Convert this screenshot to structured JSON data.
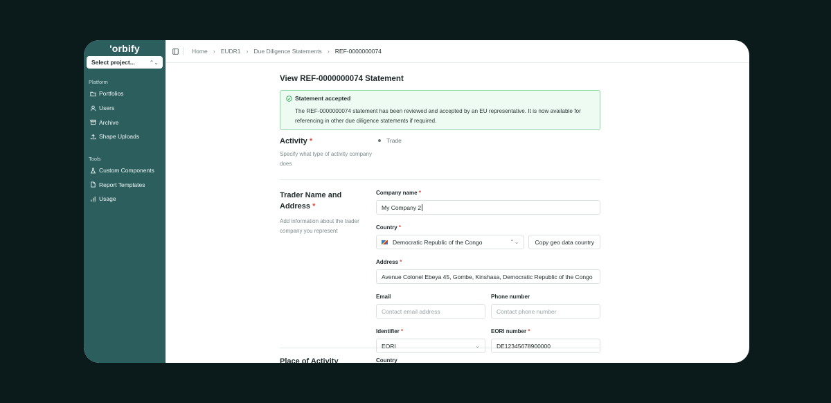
{
  "sidebar": {
    "logo": "'orbify",
    "project_select": "Select project...",
    "platform_label": "Platform",
    "platform_items": [
      {
        "label": "Portfolios",
        "icon": "folder-icon"
      },
      {
        "label": "Users",
        "icon": "user-icon"
      },
      {
        "label": "Archive",
        "icon": "archive-icon"
      },
      {
        "label": "Shape Uploads",
        "icon": "upload-icon"
      }
    ],
    "tools_label": "Tools",
    "tools_items": [
      {
        "label": "Custom Components",
        "icon": "flask-icon"
      },
      {
        "label": "Report Templates",
        "icon": "document-icon"
      },
      {
        "label": "Usage",
        "icon": "bar-chart-icon"
      }
    ]
  },
  "breadcrumb": [
    "Home",
    "EUDR1",
    "Due Diligence Statements",
    "REF-0000000074"
  ],
  "page_title": "View REF-0000000074 Statement",
  "alert": {
    "title": "Statement accepted",
    "body": "The REF-0000000074 statement has been reviewed and accepted by an EU representative. It is now available for referencing in other due diligence statements if required."
  },
  "activity": {
    "title": "Activity",
    "description": "Specify what type of activity company does",
    "value": "Trade"
  },
  "trader": {
    "title_line1": "Trader Name and",
    "title_line2": "Address",
    "description": "Add information about the trader company you represent",
    "company_name_label": "Company name",
    "company_name_value": "My Company 2",
    "country_label": "Country",
    "country_value": "Democratic Republic of the Congo",
    "copy_button": "Copy geo data country",
    "address_label": "Address",
    "address_value": "Avenue Colonel Ebeya 45, Gombe, Kinshasa, Democratic Republic of the Congo",
    "email_label": "Email",
    "email_placeholder": "Contact email address",
    "phone_label": "Phone number",
    "phone_placeholder": "Contact phone number",
    "identifier_label": "Identifier",
    "identifier_value": "EORI",
    "eori_label": "EORI number",
    "eori_value": "DE12345678900000"
  },
  "next_section": {
    "title": "Place of Activity",
    "field_label": "Country"
  },
  "colors": {
    "sidebar_bg": "#2c5e5e",
    "alert_border": "#8fd6a6",
    "alert_bg": "#eefbf2",
    "required": "#e0483e"
  }
}
